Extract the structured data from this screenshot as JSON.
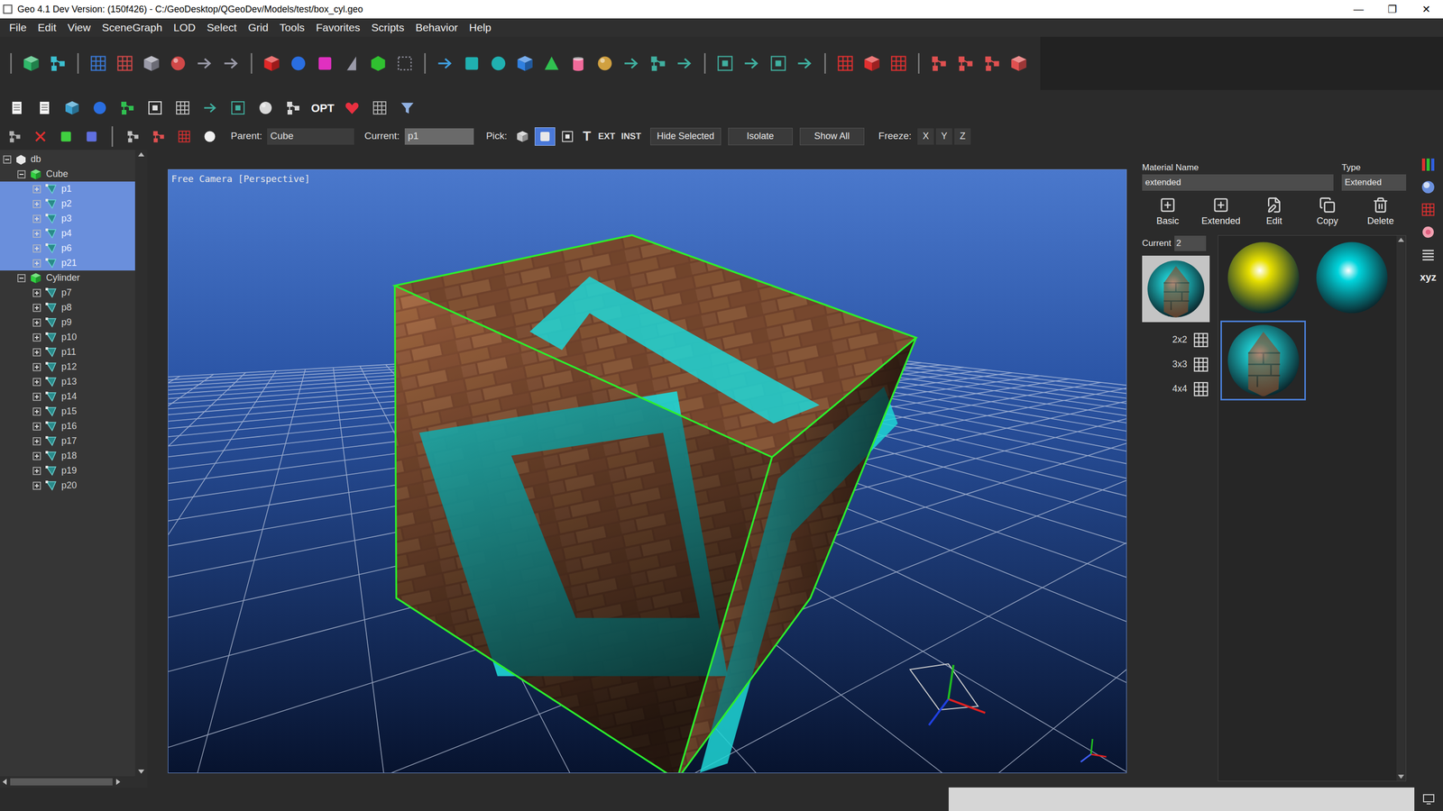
{
  "window": {
    "title": "Geo 4.1 Dev Version: (150f426) - C:/GeoDesktop/QGeoDev/Models/test/box_cyl.geo",
    "controls": [
      "—",
      "❐",
      "✕"
    ]
  },
  "menu": [
    "File",
    "Edit",
    "View",
    "SceneGraph",
    "LOD",
    "Select",
    "Grid",
    "Tools",
    "Favorites",
    "Scripts",
    "Behavior",
    "Help"
  ],
  "toolbar2": {
    "opt_label": "OPT"
  },
  "toolbar3": {
    "parent_label": "Parent:",
    "parent_value": "Cube",
    "current_label": "Current:",
    "current_value": "p1",
    "pick_label": "Pick:",
    "pick_icons": [
      {
        "selected": false
      },
      {
        "selected": true
      },
      {
        "selected": false
      }
    ],
    "pick_text": [
      "T",
      "EXT",
      "INST"
    ],
    "buttons": [
      "Hide Selected",
      "Isolate",
      "Show All"
    ],
    "freeze_label": "Freeze:",
    "freeze_axes": [
      "X",
      "Y",
      "Z"
    ]
  },
  "tree": {
    "root": {
      "label": "db",
      "expanded": true
    },
    "groups": [
      {
        "label": "Cube",
        "expanded": true,
        "items": [
          {
            "label": "p1",
            "selected": true,
            "expanded": false
          },
          {
            "label": "p2",
            "selected": true,
            "expanded": false
          },
          {
            "label": "p3",
            "selected": true,
            "expanded": false
          },
          {
            "label": "p4",
            "selected": true,
            "expanded": false
          },
          {
            "label": "p6",
            "selected": true,
            "expanded": false
          },
          {
            "label": "p21",
            "selected": true,
            "expanded": false
          }
        ]
      },
      {
        "label": "Cylinder",
        "expanded": true,
        "items": [
          {
            "label": "p7",
            "selected": false,
            "expanded": false
          },
          {
            "label": "p8",
            "selected": false,
            "expanded": false
          },
          {
            "label": "p9",
            "selected": false,
            "expanded": false
          },
          {
            "label": "p10",
            "selected": false,
            "expanded": false
          },
          {
            "label": "p11",
            "selected": false,
            "expanded": false
          },
          {
            "label": "p12",
            "selected": false,
            "expanded": false
          },
          {
            "label": "p13",
            "selected": false,
            "expanded": false
          },
          {
            "label": "p14",
            "selected": false,
            "expanded": false
          },
          {
            "label": "p15",
            "selected": false,
            "expanded": false
          },
          {
            "label": "p16",
            "selected": false,
            "expanded": false
          },
          {
            "label": "p17",
            "selected": false,
            "expanded": false
          },
          {
            "label": "p18",
            "selected": false,
            "expanded": false
          },
          {
            "label": "p19",
            "selected": false,
            "expanded": false
          },
          {
            "label": "p20",
            "selected": false,
            "expanded": false
          }
        ]
      }
    ]
  },
  "viewport": {
    "label": "Free Camera [Perspective]"
  },
  "material": {
    "name_label": "Material Name",
    "name_value": "extended",
    "type_label": "Type",
    "type_value": "Extended",
    "actions": [
      "Basic",
      "Extended",
      "Edit",
      "Copy",
      "Delete"
    ],
    "current_label": "Current",
    "current_value": "2",
    "grid_options": [
      "2x2",
      "3x3",
      "4x4"
    ],
    "swatches": [
      {
        "kind": "solid",
        "color": "#e8e000",
        "selected": false
      },
      {
        "kind": "solid",
        "color": "#00d4dc",
        "selected": false
      },
      {
        "kind": "textured",
        "color": "#1fc8cc",
        "selected": true
      }
    ]
  },
  "side_strip": {
    "label": "xyz"
  }
}
